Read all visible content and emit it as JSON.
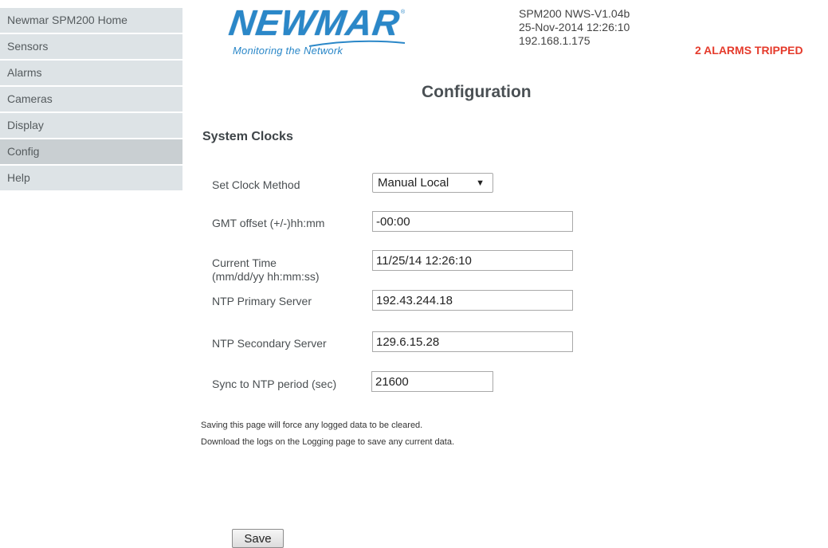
{
  "sidebar": {
    "items": [
      {
        "label": "Newmar SPM200 Home"
      },
      {
        "label": "Sensors"
      },
      {
        "label": "Alarms"
      },
      {
        "label": "Cameras"
      },
      {
        "label": "Display"
      },
      {
        "label": "Config"
      },
      {
        "label": "Help"
      }
    ],
    "active": "Config"
  },
  "logo": {
    "brand": "NEWMAR",
    "registered": "®",
    "tagline": "Monitoring the Network"
  },
  "header": {
    "version": "SPM200 NWS-V1.04b",
    "datetime": "25-Nov-2014 12:26:10",
    "ip": "192.168.1.175",
    "alarm_status": "2 ALARMS TRIPPED"
  },
  "page": {
    "title": "Configuration",
    "section": "System Clocks"
  },
  "form": {
    "clock_method": {
      "label": "Set Clock Method",
      "value": "Manual Local"
    },
    "gmt_offset": {
      "label": "GMT offset (+/-)hh:mm",
      "value": "-00:00"
    },
    "current_time": {
      "label_line1": "Current Time",
      "label_line2": "(mm/dd/yy hh:mm:ss)",
      "value": "11/25/14 12:26:10"
    },
    "ntp_primary": {
      "label": "NTP Primary Server",
      "value": "192.43.244.18"
    },
    "ntp_secondary": {
      "label": "NTP Secondary Server",
      "value": "129.6.15.28"
    },
    "sync_period": {
      "label": "Sync to NTP period (sec)",
      "value": "21600"
    }
  },
  "notes": {
    "line1": "Saving this page will force any logged data to be cleared.",
    "line2": "Download the logs on the Logging page to save any current data."
  },
  "actions": {
    "save_label": "Save"
  },
  "colors": {
    "accent": "#2a87c8",
    "alarm": "#e53b2c",
    "sidebar_bg": "#dde3e6",
    "sidebar_active_bg": "#c9cfd2"
  }
}
